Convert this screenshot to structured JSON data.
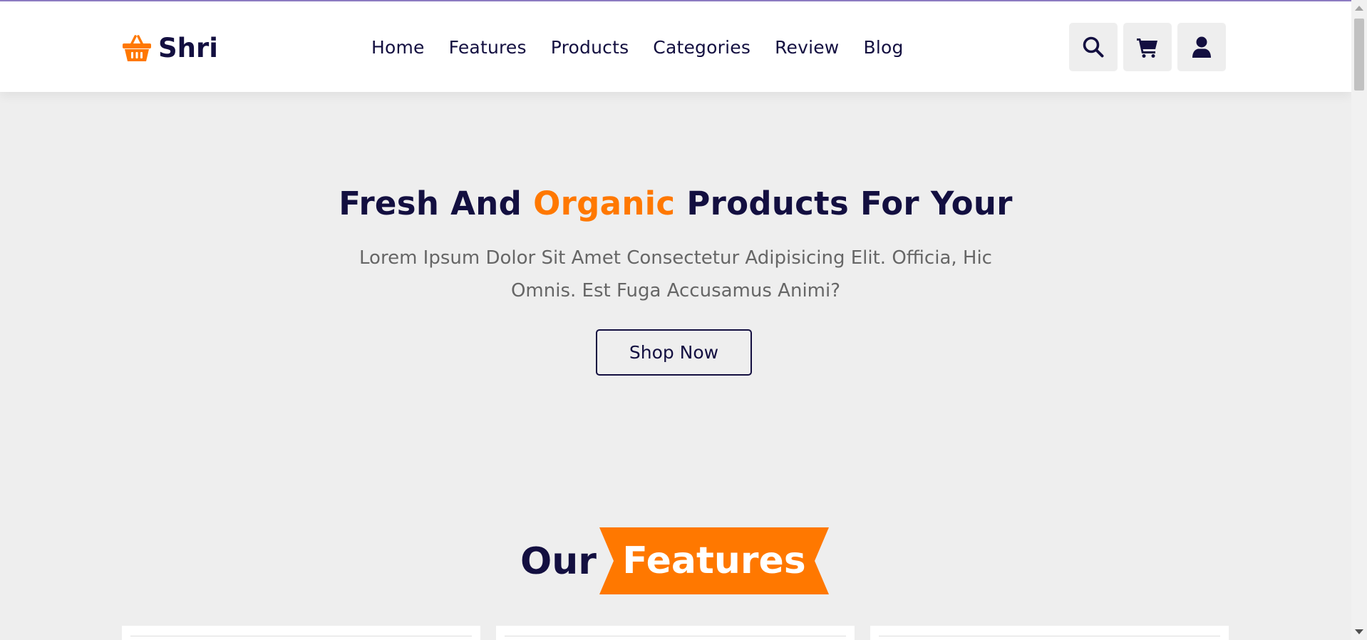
{
  "header": {
    "logo_text": "Shri",
    "logo_icon": "shopping-basket-icon",
    "nav": [
      {
        "label": "Home"
      },
      {
        "label": "Features"
      },
      {
        "label": "Products"
      },
      {
        "label": "Categories"
      },
      {
        "label": "Review"
      },
      {
        "label": "Blog"
      }
    ],
    "icons": [
      "search-icon",
      "cart-icon",
      "user-icon"
    ]
  },
  "hero": {
    "title_part1": "Fresh And ",
    "title_accent": "Organic",
    "title_part2": " Products For Your",
    "description": "Lorem Ipsum Dolor Sit Amet Consectetur Adipisicing Elit. Officia, Hic Omnis. Est Fuga Accusamus Animi?",
    "button_label": "Shop Now"
  },
  "features": {
    "heading_plain": "Our",
    "heading_highlight": "Features"
  },
  "colors": {
    "primary": "#130f40",
    "accent": "#ff7800",
    "background": "#eeeeee"
  }
}
